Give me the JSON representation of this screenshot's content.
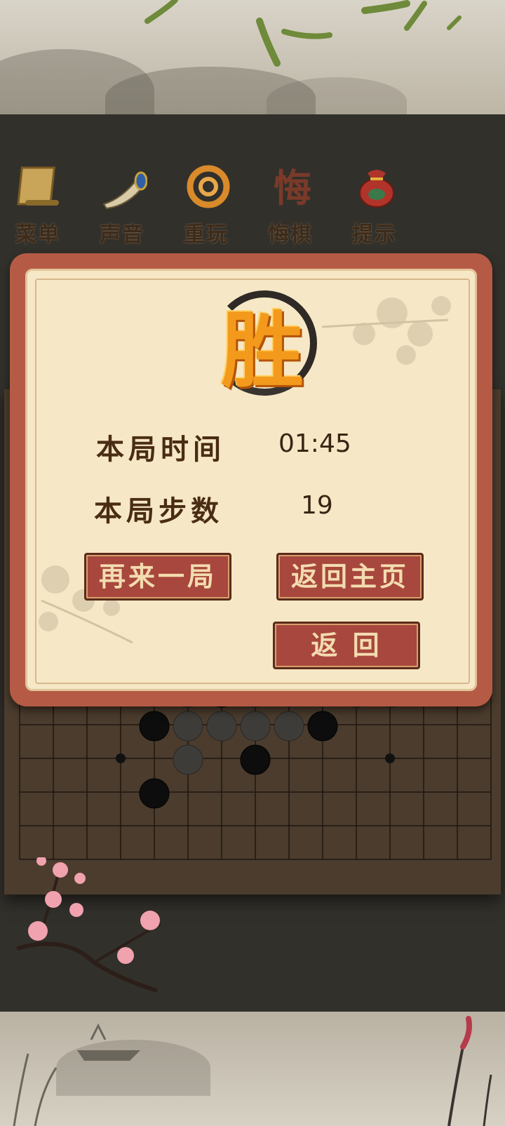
{
  "toolbar": {
    "items": [
      {
        "label": "菜单",
        "icon": "scroll-icon"
      },
      {
        "label": "声音",
        "icon": "horn-icon"
      },
      {
        "label": "重玩",
        "icon": "replay-swirl-icon"
      },
      {
        "label": "悔棋",
        "icon": "undo-character-icon"
      },
      {
        "label": "提示",
        "icon": "lucky-bag-icon"
      }
    ]
  },
  "dialog": {
    "result": "胜",
    "time_label": "本局时间",
    "time_value": "01:45",
    "steps_label": "本局步数",
    "steps_value": "19",
    "buttons": {
      "play_again": "再来一局",
      "return_home": "返回主页",
      "back": "返 回"
    }
  },
  "colors": {
    "dialog_border": "#b55a45",
    "dialog_paper": "#f6e8c6",
    "button_bg": "#a8473d",
    "win_orange": "#f39a1c",
    "board_wood": "#4a3b2c"
  },
  "board": {
    "size": "15x15",
    "visible_stones": [
      {
        "col": 6,
        "row": 0,
        "color": "black"
      },
      {
        "col": 5,
        "row": 0,
        "color": "white"
      },
      {
        "col": 7,
        "row": 0,
        "color": "white"
      },
      {
        "col": 10,
        "row": 0,
        "color": "white"
      },
      {
        "col": 11,
        "row": 0,
        "color": "white"
      },
      {
        "col": 4,
        "row": 1,
        "color": "black"
      },
      {
        "col": 5,
        "row": 1,
        "color": "white"
      },
      {
        "col": 6,
        "row": 1,
        "color": "white"
      },
      {
        "col": 7,
        "row": 1,
        "color": "white"
      },
      {
        "col": 8,
        "row": 1,
        "color": "white"
      },
      {
        "col": 9,
        "row": 1,
        "color": "black"
      },
      {
        "col": 5,
        "row": 2,
        "color": "white"
      },
      {
        "col": 7,
        "row": 2,
        "color": "black"
      },
      {
        "col": 4,
        "row": 3,
        "color": "black"
      }
    ]
  }
}
